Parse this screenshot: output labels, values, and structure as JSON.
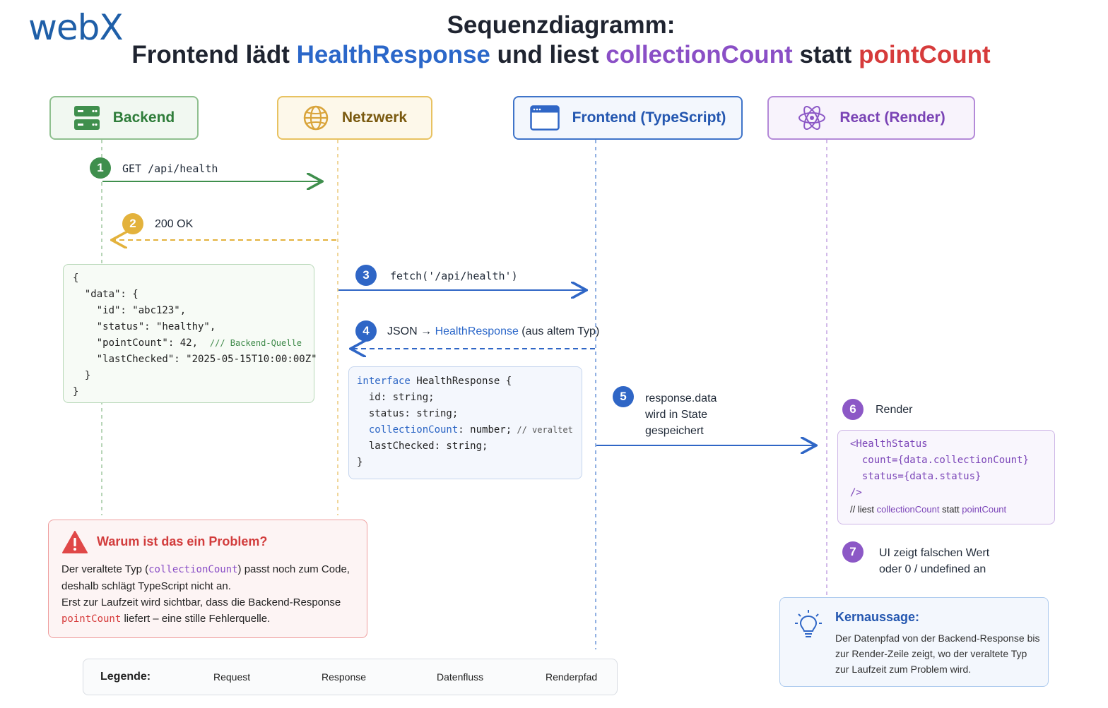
{
  "logo": "webX",
  "title": {
    "line1": "Sequenzdiagramm:",
    "part1": "Frontend lädt",
    "part2": "HealthResponse",
    "part3": "und liest",
    "part4": "collectionCount",
    "part5": "statt",
    "part6": "pointCount"
  },
  "actors": {
    "backend": "Backend",
    "network": "Netzwerk",
    "frontend": "Frontend (TypeScript)",
    "react": "React (Render)"
  },
  "steps": {
    "s1": {
      "num": "1",
      "label": "GET /api/health"
    },
    "s2": {
      "num": "2",
      "label": "200 OK"
    },
    "s3": {
      "num": "3",
      "label": "fetch('/api/health')"
    },
    "s4": {
      "num": "4",
      "label_a": "JSON → ",
      "label_b": "HealthResponse",
      "label_c": " (aus altem Typ)"
    },
    "s5": {
      "num": "5",
      "line1": "response.data",
      "line2": "wird in State",
      "line3": "gespeichert"
    },
    "s6": {
      "num": "6",
      "label": "Render"
    },
    "s7": {
      "num": "7",
      "line1": "UI zeigt falschen Wert",
      "line2": "oder 0 / undefined an"
    }
  },
  "json_code": {
    "l1": "{",
    "l2": "  \"data\": {",
    "l3": "    \"id\": \"abc123\",",
    "l4": "    \"status\": \"healthy\",",
    "l5_key": "    \"pointCount\"",
    "l5_val": ": 42,  ",
    "l5_comment": "/// Backend-Quelle",
    "l6": "    \"lastChecked\": \"2025-05-15T10:00:00Z\"",
    "l7": "  }",
    "l8": "}"
  },
  "interface_code": {
    "kw": "interface",
    "name": " HealthResponse {",
    "l2": "  id: string;",
    "l3": "  status: string;",
    "l4_key": "  collectionCount",
    "l4_val": ": number;",
    "l4_comment": " // veraltet",
    "l5": "  lastChecked: string;",
    "l6": "}"
  },
  "render_code": {
    "l1": "<HealthStatus",
    "l2_a": "  count={",
    "l2_b": "data.collectionCount",
    "l2_c": "}",
    "l3_a": "  status={",
    "l3_b": "data.status",
    "l3_c": "}",
    "l4": "/>",
    "l5_a": "// liest ",
    "l5_b": "collectionCount",
    "l5_c": " statt ",
    "l5_d": "pointCount"
  },
  "problem": {
    "title": "Warum ist das ein Problem?",
    "p1": "Der veraltete Typ (",
    "p1_code": "collectionCount",
    "p1_end": ") passt noch zum Code,",
    "p2": "deshalb schlägt TypeScript nicht an.",
    "p3": "Erst zur Laufzeit wird sichtbar, dass die Backend-Response",
    "p4_code": "pointCount",
    "p4_end": " liefert – eine stille Fehlerquelle."
  },
  "legend": {
    "title": "Legende:",
    "request": "Request",
    "response": "Response",
    "dataflow": "Datenfluss",
    "render": "Renderpfad"
  },
  "kern": {
    "title": "Kernaussage:",
    "body": "Der Datenpfad von der Backend-Response bis zur Render-Zeile zeigt, wo der veraltete Typ zur Laufzeit zum Problem wird."
  },
  "colors": {
    "request": "#3f8f4d",
    "response": "#e3b23c",
    "dataflow": "#2f66c6",
    "render": "#8c58c6",
    "problem": "#d63b3b"
  },
  "icons": {
    "backend": "server-icon",
    "network": "globe-icon",
    "frontend": "browser-window-icon",
    "react": "react-atom-icon",
    "problem": "warning-icon",
    "kern": "lightbulb-icon"
  }
}
